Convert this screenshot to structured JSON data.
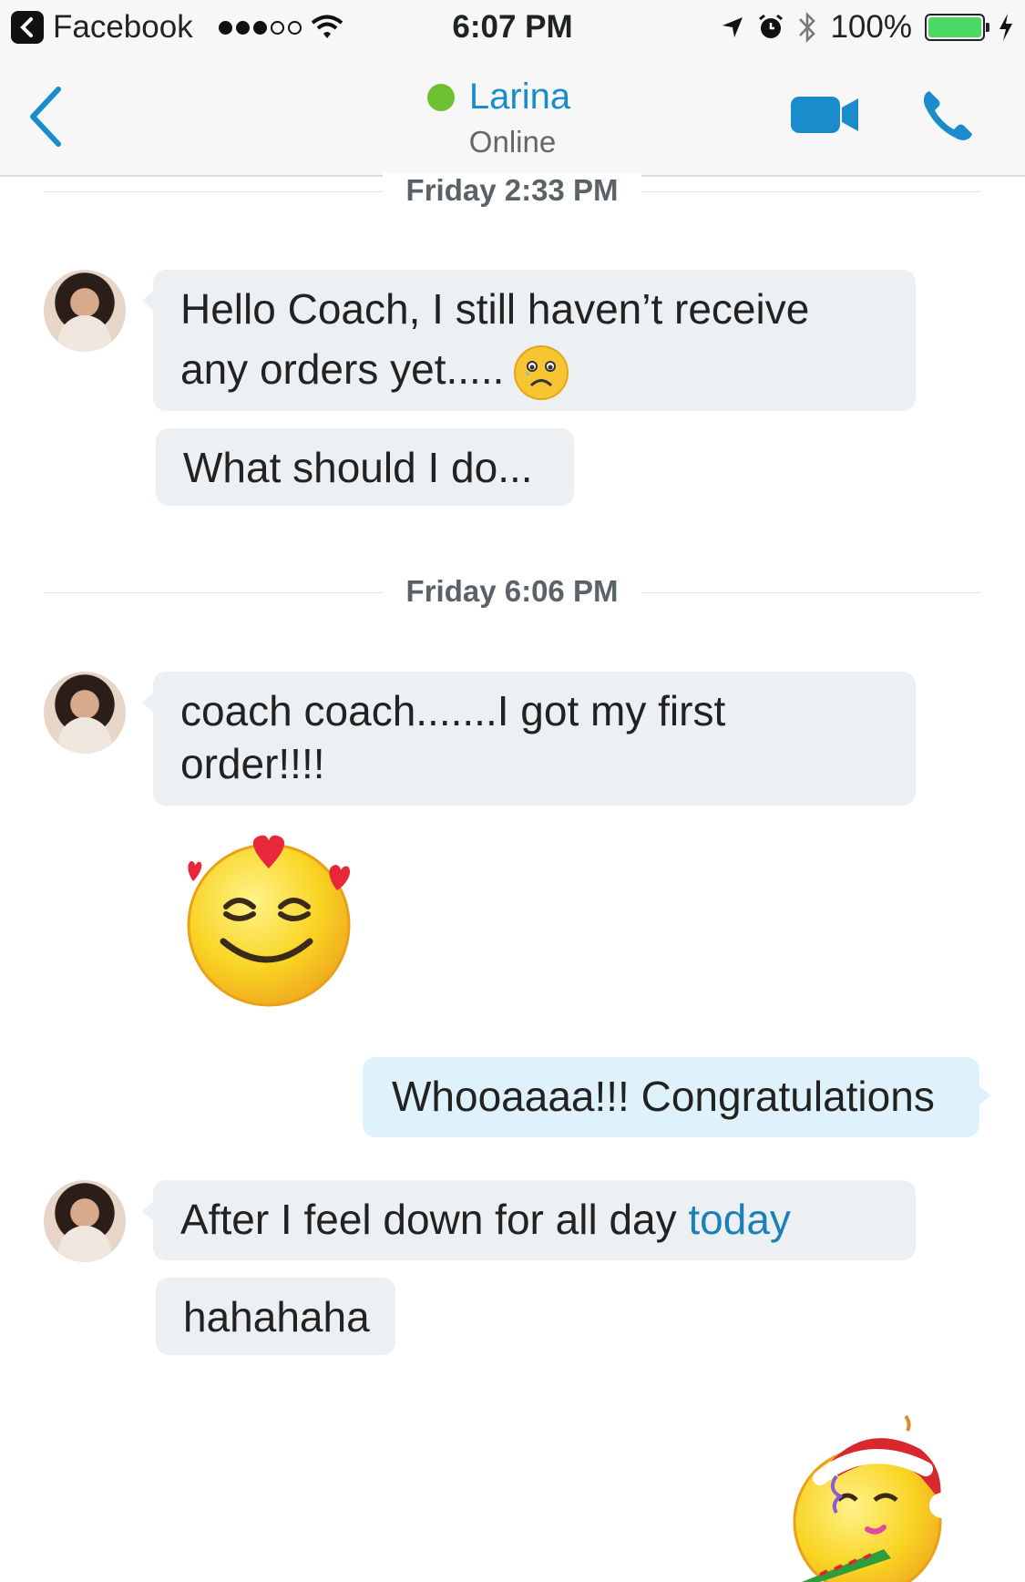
{
  "status_bar": {
    "carrier": "Facebook",
    "time": "6:07 PM",
    "battery": "100%",
    "battery_level": 1.0
  },
  "header": {
    "contact_name": "Larina",
    "contact_status": "Online"
  },
  "conversation": [
    {
      "type": "timestamp",
      "text": "Friday 2:33 PM"
    },
    {
      "type": "incoming",
      "lines": [
        "Hello Coach, I still haven’t receive",
        "any orders yet....."
      ],
      "emoji": "sad-emoji"
    },
    {
      "type": "incoming",
      "text": "What should I do..."
    },
    {
      "type": "timestamp",
      "text": "Friday 6:06 PM"
    },
    {
      "type": "incoming",
      "lines": [
        "coach coach.......I got my first",
        "order!!!!"
      ]
    },
    {
      "type": "sticker",
      "emoji": "in-love-emoji"
    },
    {
      "type": "outgoing",
      "text": "Whooaaaa!!! Congratulations"
    },
    {
      "type": "incoming",
      "text_before": "After I feel down for all day ",
      "link_text": "today"
    },
    {
      "type": "incoming",
      "text": "hahahaha"
    },
    {
      "type": "sticker",
      "emoji": "party-santa-emoji"
    }
  ],
  "colors": {
    "accent": "#1a8ccc",
    "presence": "#6dc130",
    "incoming_bubble": "#edf0f2",
    "outgoing_bubble": "#dff2fb"
  }
}
